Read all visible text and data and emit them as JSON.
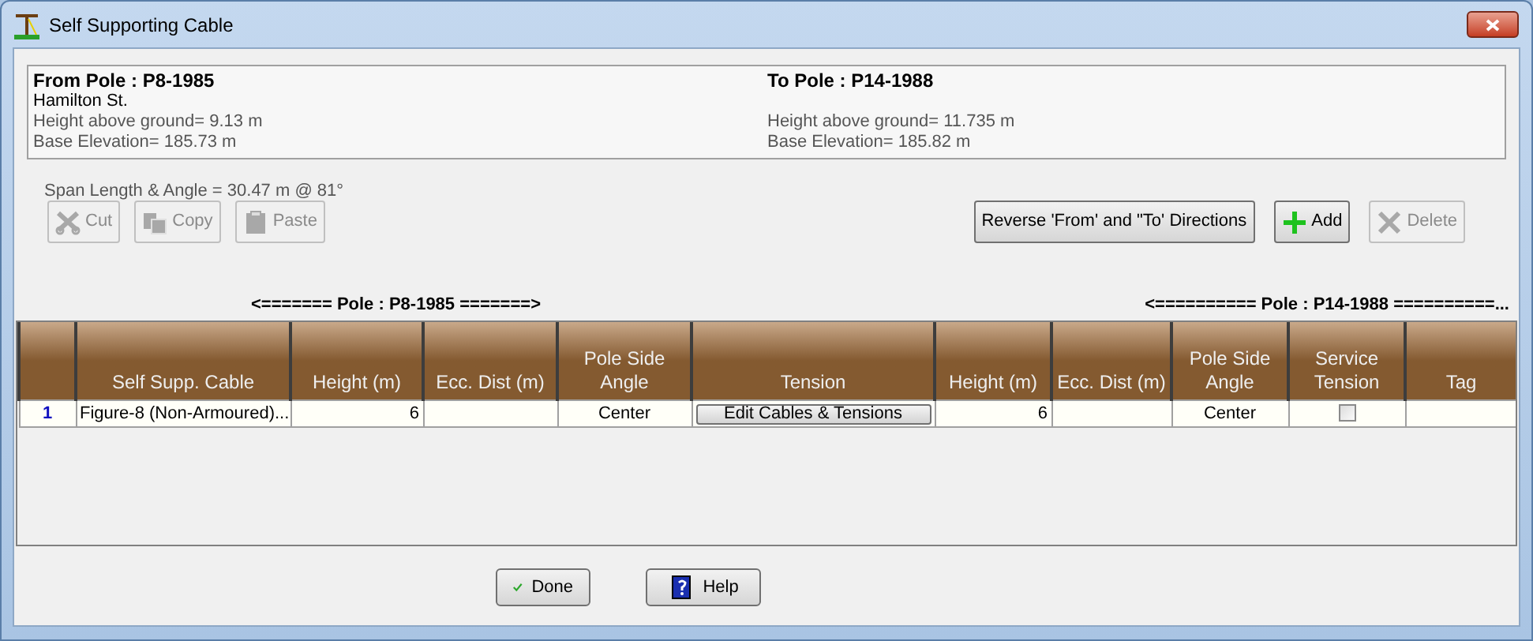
{
  "window": {
    "title": "Self Supporting Cable"
  },
  "from_pole": {
    "heading": "From Pole : P8-1985",
    "street": "Hamilton St.",
    "height": "Height above ground= 9.13 m",
    "elevation": "Base Elevation= 185.73 m"
  },
  "to_pole": {
    "heading": "To Pole : P14-1988",
    "height": "Height above ground= 11.735 m",
    "elevation": "Base Elevation= 185.82 m"
  },
  "span": "Span Length & Angle = 30.47 m @ 81°",
  "left_buttons": [
    {
      "label": "Cut",
      "kind": "cut",
      "disabled": true
    },
    {
      "label": "Copy",
      "kind": "copy",
      "disabled": true
    },
    {
      "label": "Paste",
      "kind": "paste",
      "disabled": true
    }
  ],
  "right_buttons": [
    {
      "label": "Reverse 'From' and \"To' Directions",
      "kind": "plain",
      "disabled": false
    },
    {
      "label": "Add",
      "kind": "add",
      "disabled": false
    },
    {
      "label": "Delete",
      "kind": "delete",
      "disabled": true
    }
  ],
  "pole_headers": [
    "<=======  Pole : P8-1985  =======>",
    "<==========  Pole : P14-1988  ==========..."
  ],
  "table": {
    "columns": [
      "",
      "Self Supp. Cable",
      "Height (m)",
      "Ecc. Dist (m)",
      "Pole Side Angle",
      "Tension",
      "Height (m)",
      "Ecc. Dist (m)",
      "Pole Side Angle",
      "Service Tension",
      "Tag"
    ],
    "rows": [
      {
        "cells": [
          {
            "kind": "index",
            "text": "1"
          },
          {
            "kind": "text",
            "text": "Figure-8 (Non-Armoured)..."
          },
          {
            "kind": "number",
            "text": "6"
          },
          {
            "kind": "empty"
          },
          {
            "kind": "choice",
            "text": "Center"
          },
          {
            "kind": "button",
            "text": "Edit Cables & Tensions"
          },
          {
            "kind": "number",
            "text": "6"
          },
          {
            "kind": "empty"
          },
          {
            "kind": "choice",
            "text": "Center"
          },
          {
            "kind": "checkbox",
            "checked": false
          },
          {
            "kind": "empty"
          }
        ]
      }
    ]
  },
  "footer_buttons": [
    {
      "label": "Done",
      "kind": "done"
    },
    {
      "label": "Help",
      "kind": "help"
    }
  ]
}
